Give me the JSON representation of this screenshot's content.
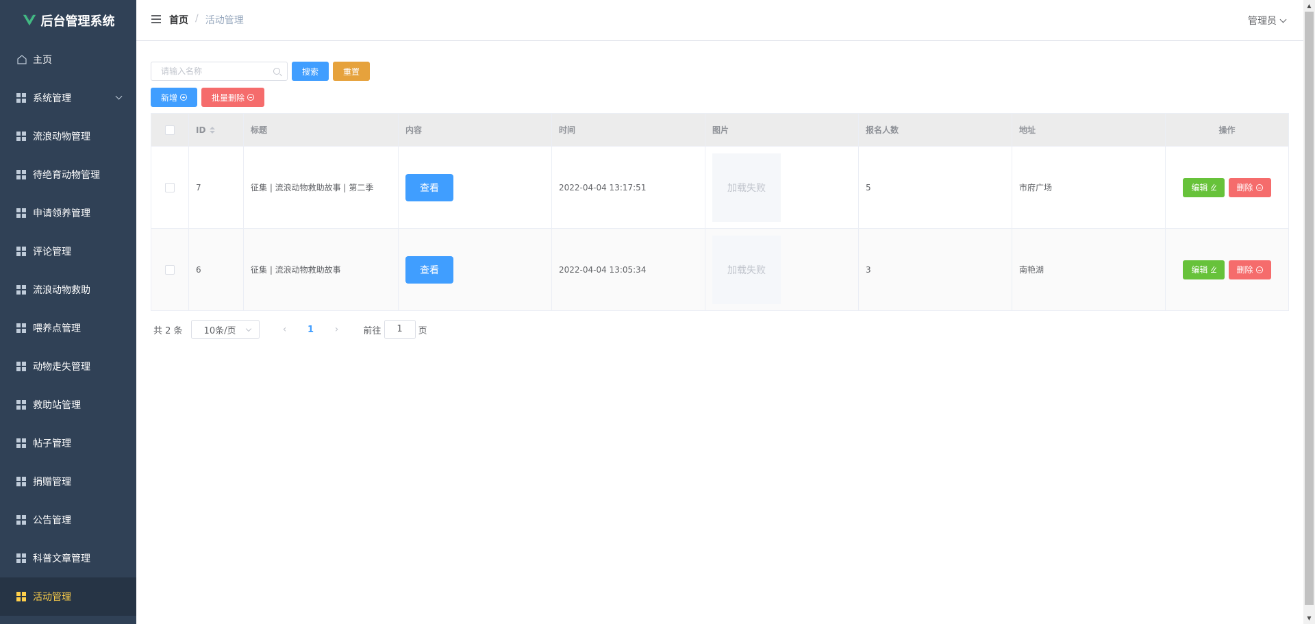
{
  "app": {
    "title": "后台管理系统",
    "brand_color": "#42b983"
  },
  "sidebar": {
    "items": [
      {
        "label": "主页",
        "icon": "home-icon"
      },
      {
        "label": "系统管理",
        "icon": "grid-icon",
        "expandable": true
      },
      {
        "label": "流浪动物管理",
        "icon": "grid-icon"
      },
      {
        "label": "待绝育动物管理",
        "icon": "grid-icon"
      },
      {
        "label": "申请领养管理",
        "icon": "grid-icon"
      },
      {
        "label": "评论管理",
        "icon": "grid-icon"
      },
      {
        "label": "流浪动物救助",
        "icon": "grid-icon"
      },
      {
        "label": "喂养点管理",
        "icon": "grid-icon"
      },
      {
        "label": "动物走失管理",
        "icon": "grid-icon"
      },
      {
        "label": "救助站管理",
        "icon": "grid-icon"
      },
      {
        "label": "帖子管理",
        "icon": "grid-icon"
      },
      {
        "label": "捐赠管理",
        "icon": "grid-icon"
      },
      {
        "label": "公告管理",
        "icon": "grid-icon"
      },
      {
        "label": "科普文章管理",
        "icon": "grid-icon"
      },
      {
        "label": "活动管理",
        "icon": "grid-icon",
        "active": true
      }
    ]
  },
  "header": {
    "breadcrumb": {
      "home": "首页",
      "separator": "/",
      "current": "活动管理"
    },
    "user": "管理员"
  },
  "toolbar": {
    "search_placeholder": "请输入名称",
    "search_label": "搜索",
    "reset_label": "重置",
    "add_label": "新增",
    "batch_delete_label": "批量删除"
  },
  "table": {
    "columns": [
      "ID",
      "标题",
      "内容",
      "时间",
      "图片",
      "报名人数",
      "地址",
      "操作"
    ],
    "rows": [
      {
        "id": "7",
        "title": "征集 | 流浪动物救助故事 | 第二季",
        "content_btn": "查看",
        "time": "2022-04-04 13:17:51",
        "image": "加载失败",
        "count": "5",
        "address": "市府广场",
        "edit": "编辑",
        "delete": "删除"
      },
      {
        "id": "6",
        "title": "征集 | 流浪动物救助故事",
        "content_btn": "查看",
        "time": "2022-04-04 13:05:34",
        "image": "加载失败",
        "count": "3",
        "address": "南艳湖",
        "edit": "编辑",
        "delete": "删除"
      }
    ]
  },
  "pagination": {
    "total": "共 2 条",
    "page_size": "10条/页",
    "current_page": "1",
    "goto_prefix": "前往",
    "goto_value": "1",
    "goto_suffix": "页"
  },
  "colors": {
    "sidebar_bg": "#304156",
    "active": "#ffd04b",
    "primary": "#409eff",
    "warning": "#e6a23c",
    "danger": "#f56c6c",
    "success": "#67c23a"
  }
}
